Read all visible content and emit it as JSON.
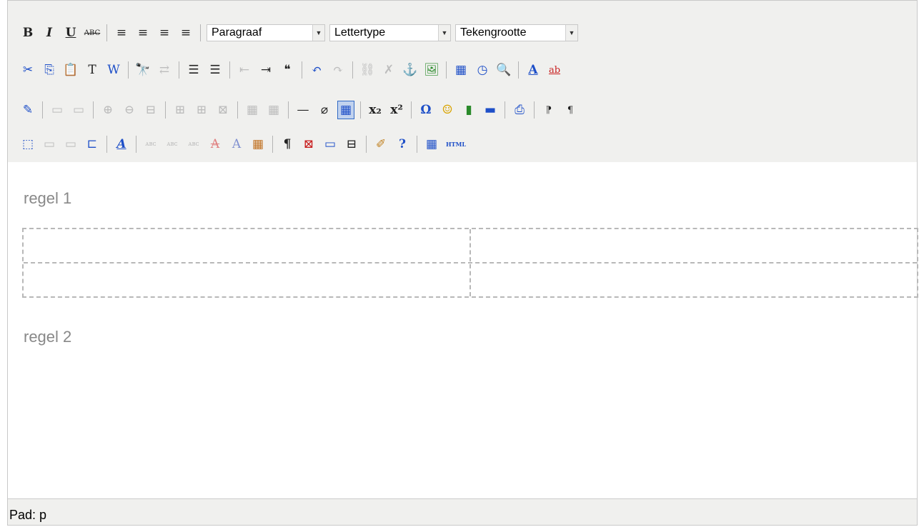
{
  "toolbar": {
    "row1_buttons": [
      {
        "name": "bold",
        "glyph": "B"
      },
      {
        "name": "italic",
        "glyph": "I"
      },
      {
        "name": "underline",
        "glyph": "U"
      },
      {
        "name": "strikethrough",
        "glyph": "ABC"
      }
    ],
    "align": [
      "≡",
      "≡",
      "≡",
      "≡"
    ],
    "paragraph_select": "Paragraaf",
    "font_select": "Lettertype",
    "size_select": "Tekengrootte",
    "row2": [
      "✂",
      "⎘",
      "📋",
      "T",
      "W",
      "🔭",
      "⇄",
      "☰",
      "☰",
      "⇤",
      "⇥",
      "❝",
      "↶",
      "↷",
      "⛓",
      "✗",
      "⚓",
      "🖼",
      "▦",
      "◷",
      "🔍",
      "A",
      "ab"
    ],
    "row3": [
      "✎",
      "▭",
      "▭",
      "⊕",
      "⊖",
      "⊟",
      "⊞",
      "⊞",
      "⊠",
      "▦",
      "▦",
      "—",
      "⌀",
      "▦",
      "x₂",
      "x²",
      "Ω",
      "☺",
      "▮",
      "▬",
      "⎙",
      "⁋",
      "¶"
    ],
    "row4": [
      "⬚",
      "▭",
      "▭",
      "⊏",
      "A",
      "ᴀʙᴄ",
      "ᴀʙᴄ",
      "ᴀʙᴄ",
      "A",
      "A",
      "▦",
      "¶",
      "⊠",
      "▭",
      "⊟",
      "✐",
      "?",
      "▦",
      "HTML"
    ]
  },
  "content": {
    "paragraph1": "regel 1",
    "paragraph2": "regel 2"
  },
  "status": {
    "path": "Pad: p"
  }
}
